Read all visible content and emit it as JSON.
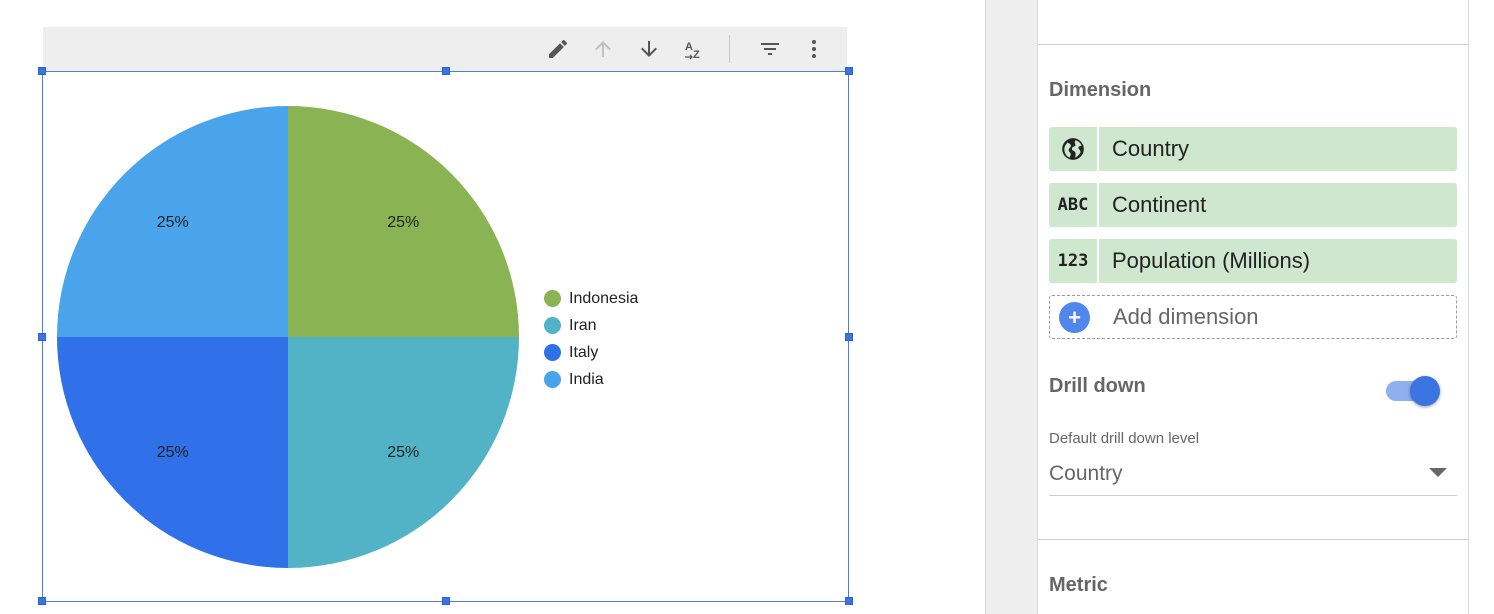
{
  "toolbar": {
    "icons": [
      "edit-icon",
      "sort-ascending-icon",
      "sort-descending-icon",
      "sort-az-icon",
      "filter-icon",
      "more-vertical-icon"
    ]
  },
  "chart_data": {
    "type": "pie",
    "categories": [
      "Indonesia",
      "Iran",
      "Italy",
      "India"
    ],
    "values": [
      25,
      25,
      25,
      25
    ],
    "labels": [
      "25%",
      "25%",
      "25%",
      "25%"
    ],
    "colors": [
      "#8ab353",
      "#52b3c7",
      "#3070e8",
      "#4aa4ec"
    ],
    "legend": {
      "placement": "right"
    }
  },
  "panel": {
    "dimension_title": "Dimension",
    "dimensions": [
      {
        "icon": "globe-icon",
        "icon_text": "",
        "label": "Country"
      },
      {
        "icon": "text-type-icon",
        "icon_text": "ABC",
        "label": "Continent"
      },
      {
        "icon": "number-type-icon",
        "icon_text": "123",
        "label": "Population (Millions)"
      }
    ],
    "add_dimension": "Add dimension",
    "drill_down": {
      "label": "Drill down",
      "enabled": true
    },
    "default_level": {
      "label": "Default drill down level",
      "value": "Country"
    },
    "metric_title": "Metric"
  },
  "colors": {
    "selection": "#4a7fe0",
    "chip": "#cfe6cf",
    "accent": "#3b73e0"
  }
}
